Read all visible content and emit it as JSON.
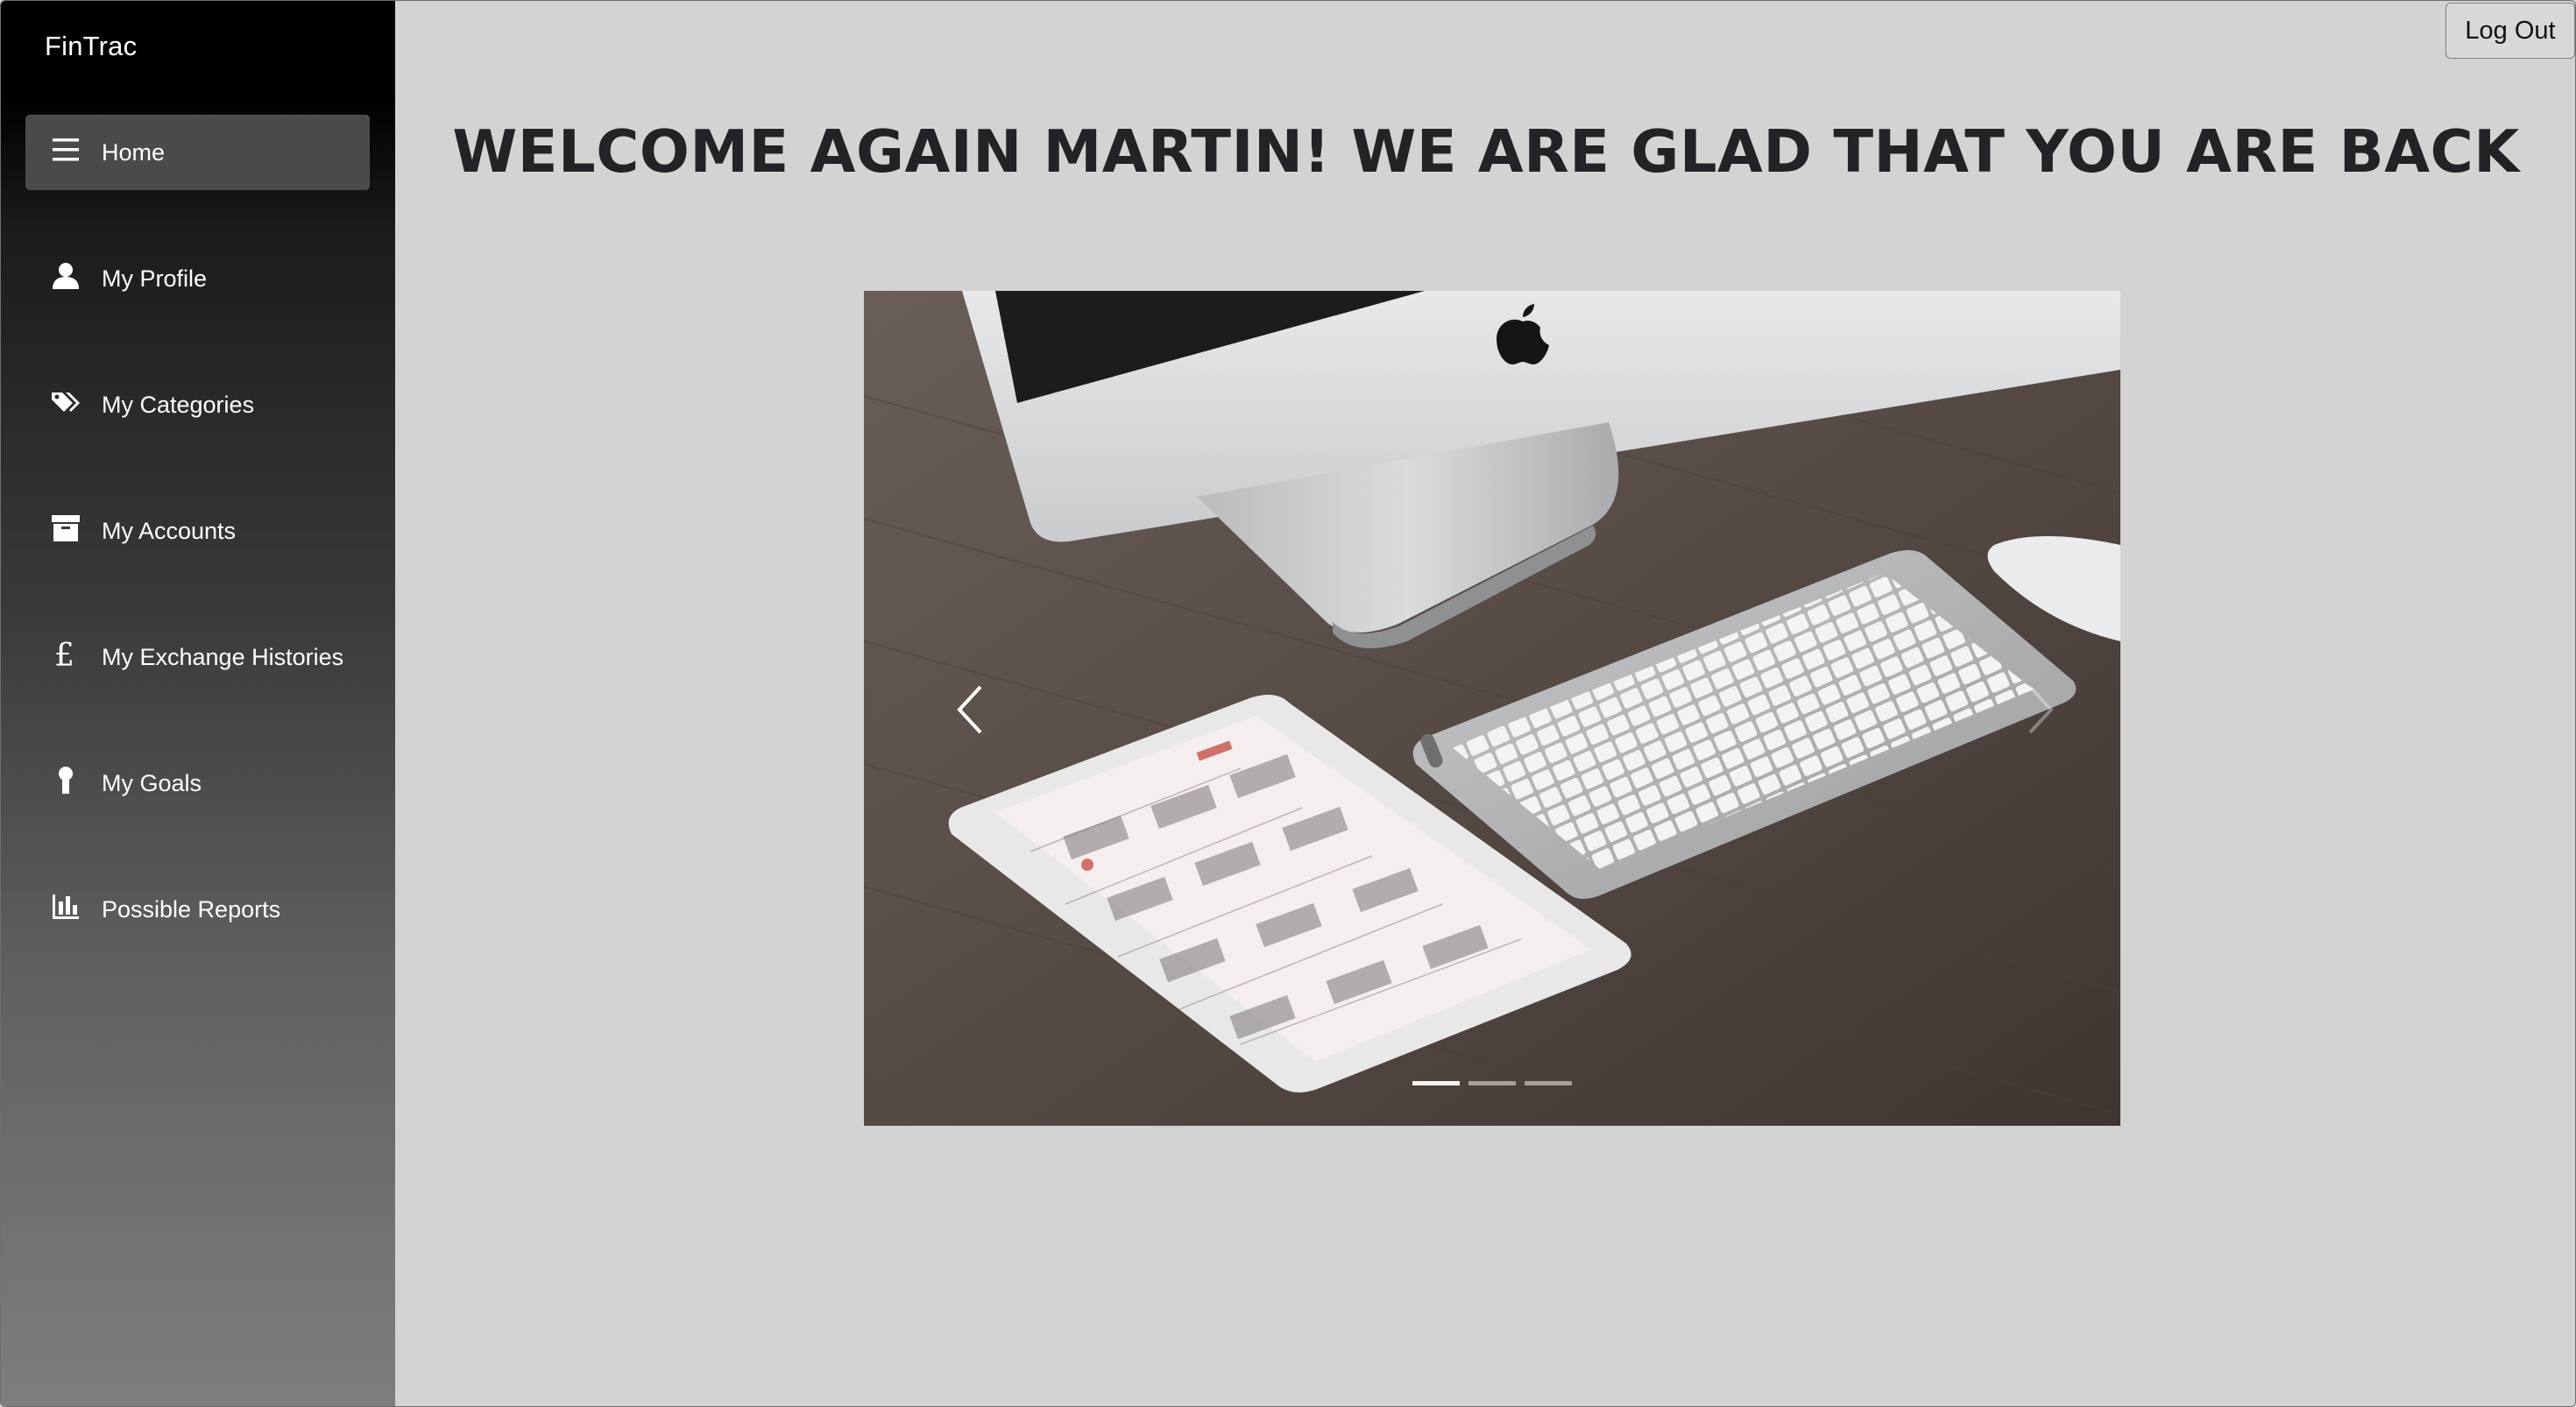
{
  "app": {
    "brand": "FinTrac"
  },
  "sidebar": {
    "items": [
      {
        "label": "Home",
        "icon": "menu-icon",
        "active": true
      },
      {
        "label": "My Profile",
        "icon": "user-icon",
        "active": false
      },
      {
        "label": "My Categories",
        "icon": "tags-icon",
        "active": false
      },
      {
        "label": "My Accounts",
        "icon": "archive-icon",
        "active": false
      },
      {
        "label": "My Exchange Histories",
        "icon": "pound-icon",
        "active": false
      },
      {
        "label": "My Goals",
        "icon": "award-icon",
        "active": false
      },
      {
        "label": "Possible Reports",
        "icon": "bar-chart-icon",
        "active": false
      }
    ]
  },
  "header": {
    "logout_label": "Log Out"
  },
  "main": {
    "welcome": "WELCOME AGAIN MARTIN! WE ARE GLAD THAT YOU ARE BACK",
    "carousel": {
      "slide_count": 3,
      "active_slide": 1,
      "image_subject": "desk-with-imac-keyboard-ipad-calendar"
    }
  },
  "colors": {
    "page_bg": "#d3d3d3",
    "sidebar_top": "#000000",
    "sidebar_bottom": "#7e7e7e",
    "active_item_bg": "#4a4a4a",
    "heading_text": "#222326"
  }
}
